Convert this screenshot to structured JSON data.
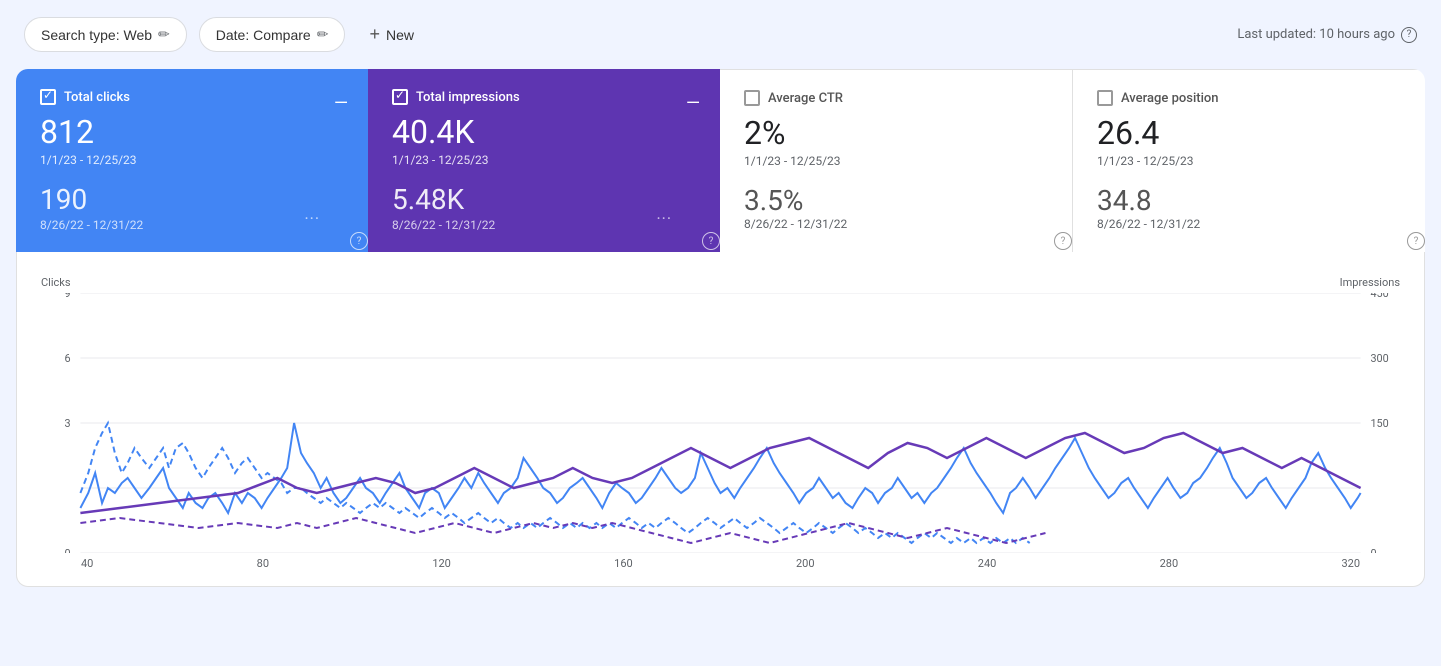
{
  "topbar": {
    "search_type_label": "Search type: Web",
    "date_label": "Date: Compare",
    "new_label": "New",
    "last_updated": "Last updated: 10 hours ago",
    "edit_icon": "✏",
    "plus_icon": "+",
    "help_icon": "?"
  },
  "metrics": [
    {
      "id": "total-clicks",
      "label": "Total clicks",
      "checked": true,
      "theme": "blue",
      "value1": "812",
      "date1": "1/1/23 - 12/25/23",
      "value2": "190",
      "date2": "8/26/22 - 12/31/22"
    },
    {
      "id": "total-impressions",
      "label": "Total impressions",
      "checked": true,
      "theme": "purple",
      "value1": "40.4K",
      "date1": "1/1/23 - 12/25/23",
      "value2": "5.48K",
      "date2": "8/26/22 - 12/31/22"
    },
    {
      "id": "average-ctr",
      "label": "Average CTR",
      "checked": false,
      "theme": "white",
      "value1": "2%",
      "date1": "1/1/23 - 12/25/23",
      "value2": "3.5%",
      "date2": "8/26/22 - 12/31/22"
    },
    {
      "id": "average-position",
      "label": "Average position",
      "checked": false,
      "theme": "white",
      "value1": "26.4",
      "date1": "1/1/23 - 12/25/23",
      "value2": "34.8",
      "date2": "8/26/22 - 12/31/22"
    }
  ],
  "chart": {
    "y_left_label": "Clicks",
    "y_right_label": "Impressions",
    "y_left_max": "9",
    "y_right_max": "450",
    "y_left_mid": "6",
    "y_right_mid1": "300",
    "y_left_low": "3",
    "y_right_low": "150",
    "y_left_zero": "0",
    "y_right_zero": "0",
    "x_labels": [
      "40",
      "80",
      "120",
      "160",
      "200",
      "240",
      "280",
      "320"
    ]
  }
}
